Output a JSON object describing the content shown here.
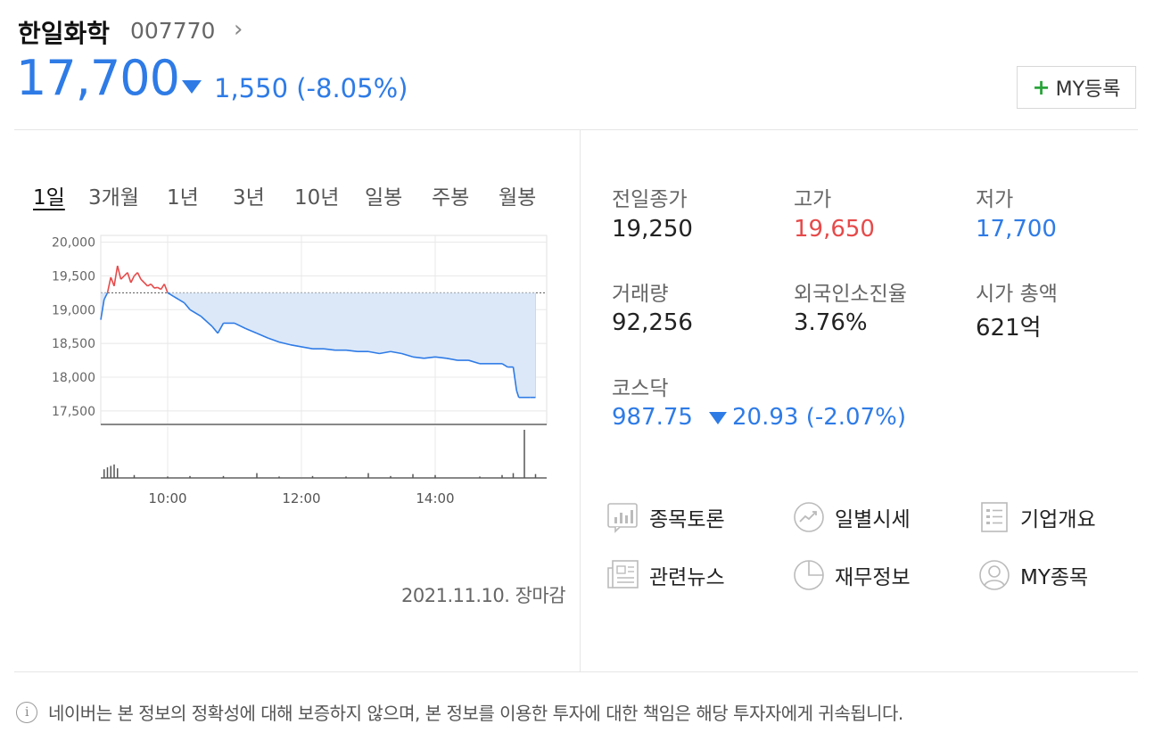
{
  "stock": {
    "name": "한일화학",
    "code": "007770",
    "code_arrow": "›",
    "price": "17,700",
    "change": "1,550 (-8.05%)",
    "my_button_label": "MY등록"
  },
  "chart": {
    "periods": [
      "1일",
      "3개월",
      "1년",
      "3년",
      "10년",
      "일봉",
      "주봉",
      "월봉"
    ],
    "active_period": "1일",
    "date_status": "2021.11.10. 장마감"
  },
  "chart_data": {
    "type": "line",
    "title": "",
    "xlabel": "",
    "ylabel": "",
    "x_ticks": [
      "10:00",
      "12:00",
      "14:00"
    ],
    "y_ticks": [
      "20,000",
      "19,500",
      "19,000",
      "18,500",
      "18,000",
      "17,500"
    ],
    "ylim": [
      17300,
      20100
    ],
    "reference_price": 19250,
    "grid": true,
    "series": [
      {
        "x": [
          "09:00",
          "09:03",
          "09:06",
          "09:09",
          "09:12",
          "09:15",
          "09:18",
          "09:21",
          "09:24",
          "09:27",
          "09:30",
          "09:33",
          "09:36",
          "09:39",
          "09:42",
          "09:45",
          "09:48",
          "09:51",
          "09:54",
          "09:57",
          "10:00",
          "10:05",
          "10:10",
          "10:15",
          "10:20",
          "10:30",
          "10:40",
          "10:45",
          "10:50",
          "11:00",
          "11:10",
          "11:20",
          "11:30",
          "11:40",
          "11:50",
          "12:00",
          "12:10",
          "12:20",
          "12:30",
          "12:40",
          "12:50",
          "13:00",
          "13:10",
          "13:20",
          "13:30",
          "13:40",
          "13:50",
          "14:00",
          "14:10",
          "14:20",
          "14:30",
          "14:40",
          "14:50",
          "15:00",
          "15:05",
          "15:10",
          "15:13",
          "15:15",
          "15:20",
          "15:25",
          "15:30"
        ],
        "values": [
          18850,
          19150,
          19250,
          19480,
          19350,
          19650,
          19450,
          19500,
          19550,
          19400,
          19500,
          19550,
          19450,
          19400,
          19350,
          19380,
          19320,
          19330,
          19300,
          19380,
          19250,
          19200,
          19150,
          19100,
          19000,
          18900,
          18750,
          18650,
          18800,
          18800,
          18720,
          18650,
          18580,
          18520,
          18480,
          18450,
          18420,
          18420,
          18400,
          18400,
          18380,
          18380,
          18350,
          18380,
          18350,
          18300,
          18280,
          18300,
          18280,
          18250,
          18250,
          18200,
          18200,
          18200,
          18150,
          18150,
          17800,
          17700,
          17700,
          17700,
          17700
        ]
      }
    ],
    "volume": {
      "x": [
        "09:03",
        "09:06",
        "09:09",
        "09:12",
        "09:15",
        "09:30",
        "10:00",
        "10:20",
        "10:50",
        "11:20",
        "11:40",
        "12:10",
        "12:40",
        "13:00",
        "13:20",
        "13:40",
        "14:00",
        "14:40",
        "15:00",
        "15:10",
        "15:20",
        "15:30"
      ],
      "values": [
        18,
        22,
        25,
        28,
        20,
        6,
        3,
        4,
        4,
        10,
        3,
        4,
        3,
        10,
        4,
        8,
        6,
        3,
        6,
        10,
        100,
        8
      ]
    },
    "colors": {
      "above_reference": "#e64a4a",
      "below_reference": "#2e7be6",
      "fill_below": "#dce8f8"
    }
  },
  "summary": {
    "items": [
      {
        "label": "전일종가",
        "value": "19,250",
        "color": "default"
      },
      {
        "label": "고가",
        "value": "19,650",
        "color": "red"
      },
      {
        "label": "저가",
        "value": "17,700",
        "color": "blue"
      },
      {
        "label": "거래량",
        "value": "92,256",
        "color": "default"
      },
      {
        "label": "외국인소진율",
        "value": "3.76%",
        "color": "default"
      },
      {
        "label": "시가 총액",
        "value": "621억",
        "color": "default"
      }
    ],
    "index": {
      "label": "코스닥",
      "value": "987.75",
      "change": "20.93 (-2.07%)"
    }
  },
  "menu": [
    {
      "label": "종목토론",
      "icon": "discussion-chart-icon"
    },
    {
      "label": "일별시세",
      "icon": "trend-up-icon"
    },
    {
      "label": "기업개요",
      "icon": "list-document-icon"
    },
    {
      "label": "관련뉴스",
      "icon": "newspaper-icon"
    },
    {
      "label": "재무정보",
      "icon": "pie-chart-icon"
    },
    {
      "label": "MY종목",
      "icon": "user-profile-icon"
    }
  ],
  "disclaimer": {
    "icon": "info-icon",
    "text": "네이버는 본 정보의 정확성에 대해 보증하지 않으며, 본 정보를 이용한 투자에 대한 책임은 해당 투자자에게 귀속됩니다."
  },
  "colors": {
    "accent_blue": "#2e7be6",
    "up_red": "#e64a4a",
    "plus_green": "#2aa43b"
  }
}
